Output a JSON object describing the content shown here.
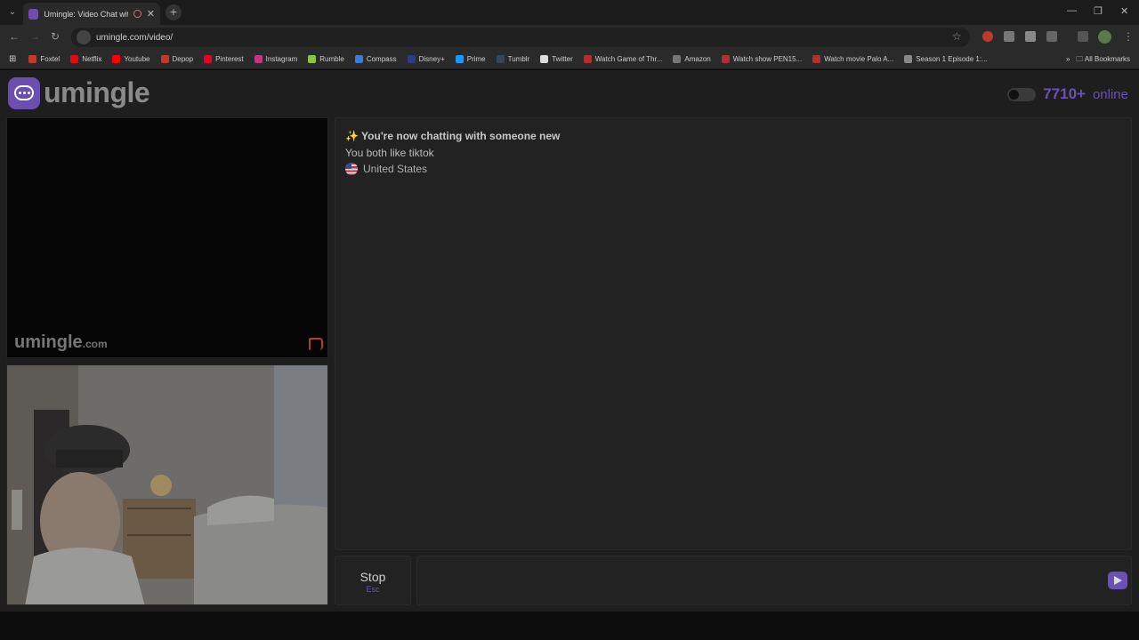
{
  "browser": {
    "tab_title": "Umingle: Video Chat with S",
    "url": "umingle.com/video/",
    "bookmarks": [
      {
        "label": "Foxtel",
        "color": "#c0392b"
      },
      {
        "label": "Netflix",
        "color": "#e50914"
      },
      {
        "label": "Youtube",
        "color": "#ff0000"
      },
      {
        "label": "Depop",
        "color": "#c0392b"
      },
      {
        "label": "Pinterest",
        "color": "#e60023"
      },
      {
        "label": "Instagram",
        "color": "#c13584"
      },
      {
        "label": "Rumble",
        "color": "#85c742"
      },
      {
        "label": "Compass",
        "color": "#3a7bd5"
      },
      {
        "label": "Disney+",
        "color": "#2c3e80"
      },
      {
        "label": "Prime",
        "color": "#1a98ff"
      },
      {
        "label": "Tumblr",
        "color": "#35465c"
      },
      {
        "label": "Twitter",
        "color": "#dddddd"
      },
      {
        "label": "Watch Game of Thr...",
        "color": "#b03030"
      },
      {
        "label": "Amazon",
        "color": "#777777"
      },
      {
        "label": "Watch show PEN15...",
        "color": "#b03030"
      },
      {
        "label": "Watch movie Palo A...",
        "color": "#b03030"
      },
      {
        "label": "Season 1 Episode 1:...",
        "color": "#888888"
      }
    ],
    "all_bookmarks": "All Bookmarks"
  },
  "site": {
    "logo_text": "umingle",
    "online_count": "7710+",
    "online_label": "online",
    "watermark": "umingle",
    "watermark_suffix": ".com"
  },
  "chat": {
    "line1": "✨ You're now chatting with someone new",
    "line2": "You both like tiktok",
    "line3": "United States"
  },
  "controls": {
    "stop_label": "Stop",
    "stop_key": "Esc",
    "input_value": ""
  },
  "colors": {
    "accent": "#6b50b8",
    "background": "#1e1e1e"
  }
}
